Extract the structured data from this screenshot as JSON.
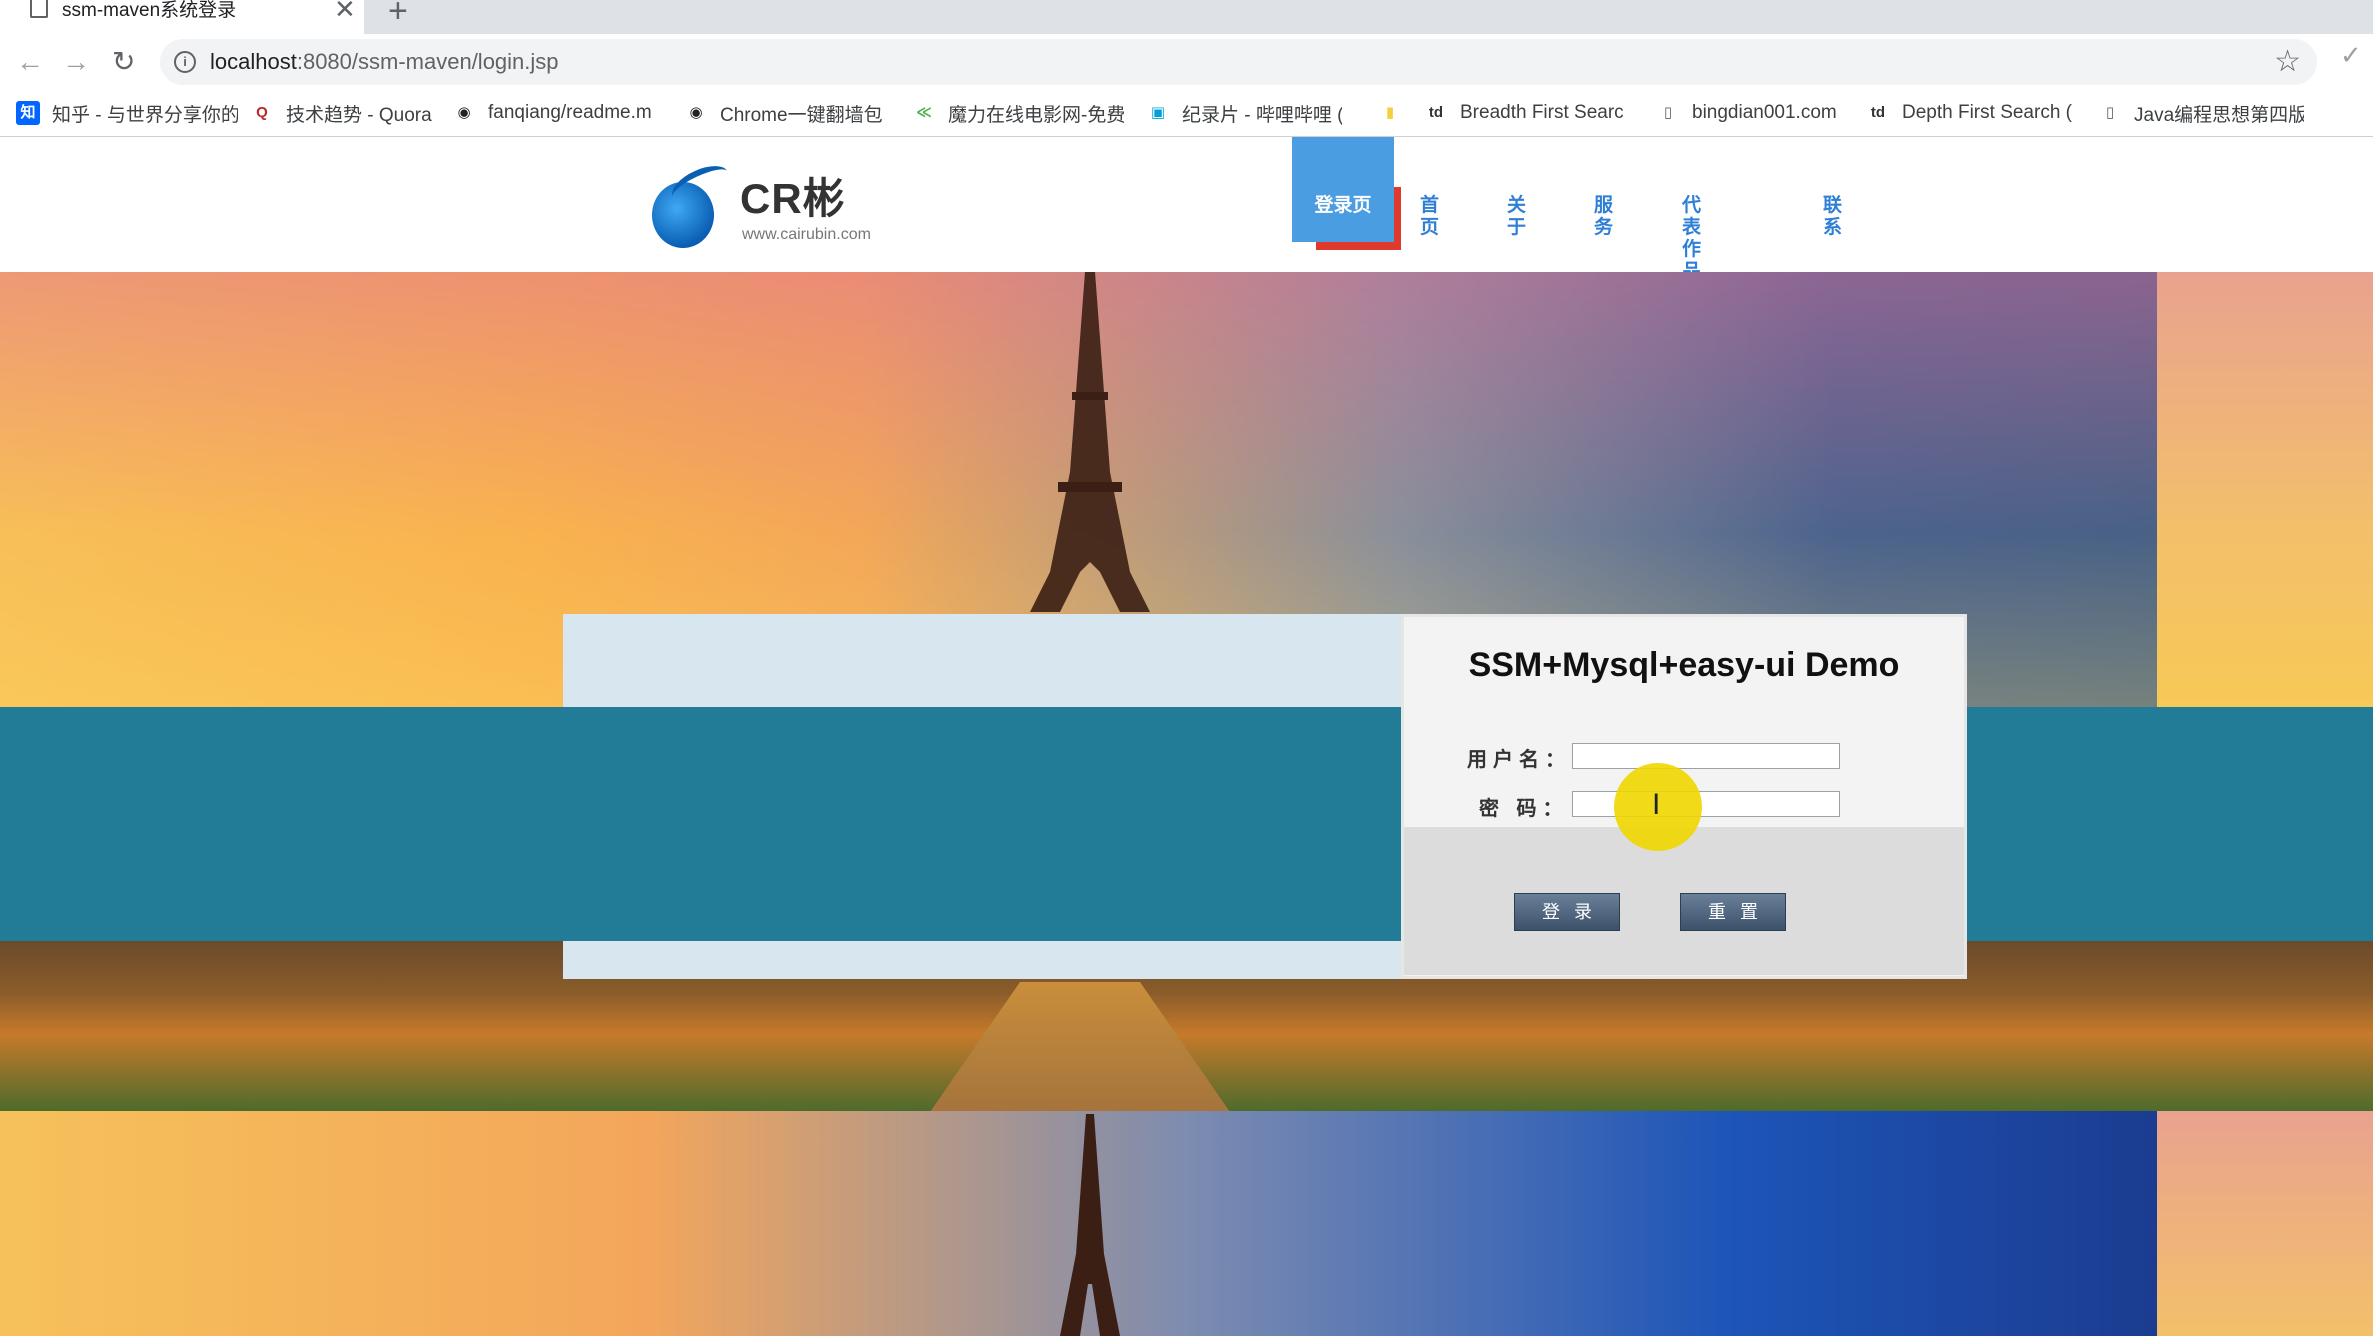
{
  "browser": {
    "tab_title": "ssm-maven系统登录",
    "tab_close": "✕",
    "new_tab": "+",
    "url_host": "localhost",
    "url_rest": ":8080/ssm-maven/login.jsp",
    "back": "←",
    "forward": "→",
    "reload": "↻",
    "info": "i",
    "star": "☆",
    "check": "✓",
    "bookmarks": [
      {
        "icon": "知",
        "label": "知乎 - 与世界分享你的",
        "color": "#0066ff"
      },
      {
        "icon": "Q",
        "label": "技术趋势 - Quora",
        "color": "#b92b27"
      },
      {
        "icon": "◉",
        "label": "fanqiang/readme.m",
        "color": "#222222"
      },
      {
        "icon": "◉",
        "label": "Chrome一键翻墙包",
        "color": "#222222"
      },
      {
        "icon": "≪",
        "label": "魔力在线电影网-免费",
        "color": "#4caf50"
      },
      {
        "icon": "▣",
        "label": "纪录片 - 哔哩哔哩 (",
        "color": "#00a1d6"
      },
      {
        "icon": "▮",
        "label": "",
        "color": "#f4d03f"
      },
      {
        "icon": "td",
        "label": "Breadth First Searc",
        "color": "#333333"
      },
      {
        "icon": "▯",
        "label": "bingdian001.com",
        "color": "#5f6368"
      },
      {
        "icon": "td",
        "label": "Depth First Search (",
        "color": "#333333"
      },
      {
        "icon": "▯",
        "label": "Java编程思想第四版",
        "color": "#5f6368"
      }
    ]
  },
  "site": {
    "logo_text": "CR彬",
    "logo_sub": "www.cairubin.com",
    "nav": {
      "active": "登录页",
      "items": [
        "首页",
        "关于",
        "服务",
        "代表作品集",
        "联系"
      ]
    }
  },
  "login": {
    "title": "SSM+Mysql+easy-ui Demo",
    "username_label": "用户名：",
    "password_label": "密 码：",
    "username_value": "",
    "password_value": "",
    "login_button": "登录",
    "reset_button": "重置"
  },
  "colors": {
    "nav_active": "#4a9de0",
    "nav_accent": "#e03a2f",
    "nav_link": "#2f7fd6",
    "teal_band": "#227c98",
    "button": "#4b5f79"
  },
  "cursor": {
    "icon": "I"
  }
}
